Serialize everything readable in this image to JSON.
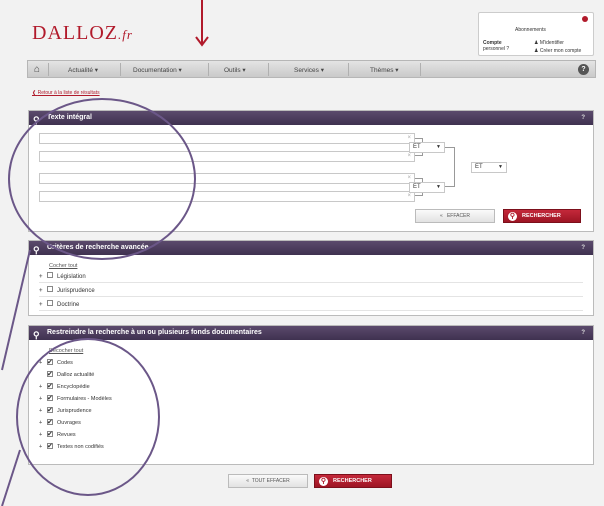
{
  "header": {
    "logo": "DALLOZ",
    "logo_suffix": ".fr",
    "account": {
      "abonnement": "Abonnements",
      "compte": "Compte",
      "personnel": "personnel ?",
      "login": "M'identifier",
      "create": "Créer mon compte"
    }
  },
  "nav": {
    "items": [
      "Actualité",
      "Documentation",
      "Outils",
      "Services",
      "Thèmes"
    ],
    "help": "?"
  },
  "back_link": "Retour à la liste de résultats",
  "texte_integral": {
    "title": "Texte intégral",
    "help": "?",
    "clear_mark": "×",
    "op1": "ET",
    "op2": "ET",
    "op3": "ET",
    "effacer": "EFFACER",
    "effacer_icon": "«",
    "rechercher": "RECHERCHER"
  },
  "criteres": {
    "title": "Critères de recherche avancée",
    "help": "?",
    "toggle": "Cocher tout",
    "items": [
      "Législation",
      "Jurisprudence",
      "Doctrine"
    ]
  },
  "fonds": {
    "title": "Restreindre la recherche à un ou plusieurs fonds documentaires",
    "help": "?",
    "toggle": "Décocher tout",
    "items": [
      {
        "label": "Codes",
        "plus": true
      },
      {
        "label": "Dalloz actualité",
        "plus": false
      },
      {
        "label": "Encyclopédie",
        "plus": true
      },
      {
        "label": "Formulaires - Modèles",
        "plus": true
      },
      {
        "label": "Jurisprudence",
        "plus": true
      },
      {
        "label": "Ouvrages",
        "plus": true
      },
      {
        "label": "Revues",
        "plus": true
      },
      {
        "label": "Textes non codifiés",
        "plus": true
      }
    ]
  },
  "footer": {
    "tout_effacer": "TOUT EFFACER",
    "tout_effacer_icon": "«",
    "rechercher": "RECHERCHER"
  },
  "colors": {
    "brand_red": "#b11a2b",
    "panel_header": "#4a3b5c",
    "annotation": "#6b5788"
  }
}
